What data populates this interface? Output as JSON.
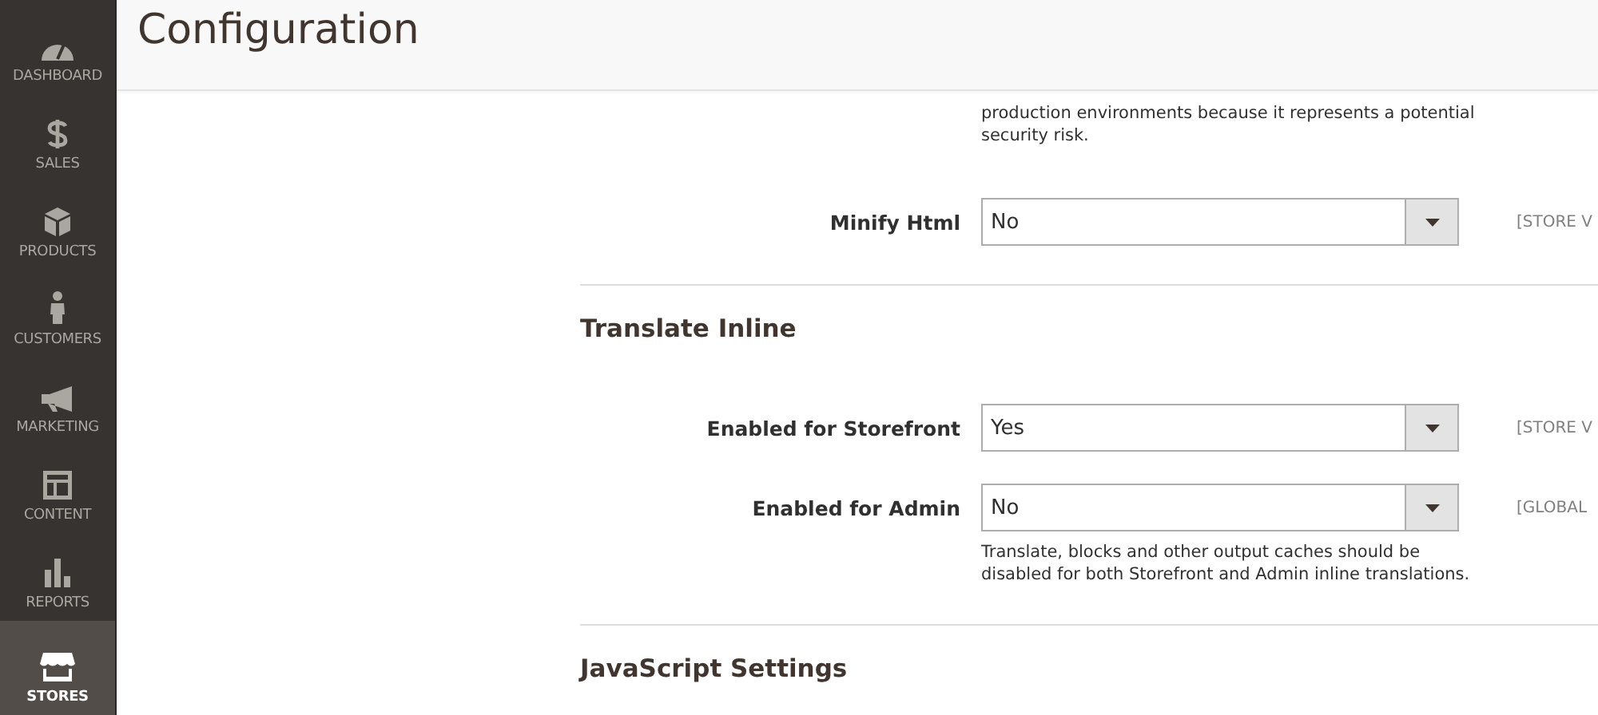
{
  "sidebar": {
    "items": [
      {
        "label": "DASHBOARD",
        "selected": false
      },
      {
        "label": "SALES",
        "selected": false
      },
      {
        "label": "PRODUCTS",
        "selected": false
      },
      {
        "label": "CUSTOMERS",
        "selected": false
      },
      {
        "label": "MARKETING",
        "selected": false
      },
      {
        "label": "CONTENT",
        "selected": false
      },
      {
        "label": "REPORTS",
        "selected": false
      },
      {
        "label": "STORES",
        "selected": true
      }
    ]
  },
  "page_title": "Configuration",
  "content": [
    {
      "kind": "note",
      "text": "production environments because it represents a potential security risk."
    },
    {
      "kind": "field",
      "label": "Minify Html",
      "value": "No",
      "scope": "[STORE V"
    },
    {
      "kind": "section",
      "title": "Translate Inline"
    },
    {
      "kind": "field",
      "label": "Enabled for Storefront",
      "value": "Yes",
      "scope": "[STORE V"
    },
    {
      "kind": "field",
      "label": "Enabled for Admin",
      "value": "No",
      "scope": "[GLOBAL"
    },
    {
      "kind": "note",
      "text": "Translate, blocks and other output caches should be disabled for both Storefront and Admin inline translations."
    },
    {
      "kind": "section",
      "title": "JavaScript Settings"
    }
  ]
}
